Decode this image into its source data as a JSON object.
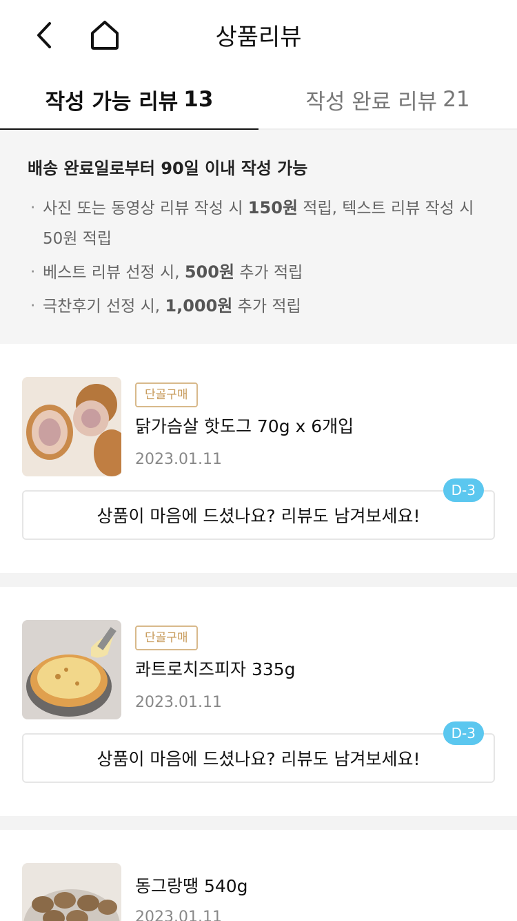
{
  "header": {
    "title": "상품리뷰"
  },
  "tabs": [
    {
      "label": "작성 가능 리뷰",
      "count": "13"
    },
    {
      "label": "작성 완료 리뷰",
      "count": "21"
    }
  ],
  "notice": {
    "title": "배송 완료일로부터 90일 이내 작성 가능",
    "items": [
      {
        "pre": "사진 또는 동영상 리뷰 작성 시 ",
        "bold": "150원",
        "post": " 적립, 텍스트 리뷰 작성 시 50원 적립"
      },
      {
        "pre": "베스트 리뷰 선정 시, ",
        "bold": "500원",
        "post": " 추가 적립"
      },
      {
        "pre": "극찬후기 선정 시, ",
        "bold": "1,000원",
        "post": " 추가 적립"
      }
    ]
  },
  "products": [
    {
      "badge": "단골구매",
      "name": "닭가슴살 핫도그 70g x 6개입",
      "date": "2023.01.11",
      "dday": "D-3",
      "review_button": "상품이 마음에 드셨나요? 리뷰도 남겨보세요!"
    },
    {
      "badge": "단골구매",
      "name": "콰트로치즈피자 335g",
      "date": "2023.01.11",
      "dday": "D-3",
      "review_button": "상품이 마음에 드셨나요? 리뷰도 남겨보세요!"
    },
    {
      "name": "동그랑땡 540g",
      "date": "2023.01.11"
    }
  ],
  "icons": {
    "back": "chevron-left-icon",
    "home": "home-icon"
  },
  "colors": {
    "badge_border": "#d8b98b",
    "dday_bg": "#5bc7ef",
    "notice_bg": "#f5f5f5"
  }
}
